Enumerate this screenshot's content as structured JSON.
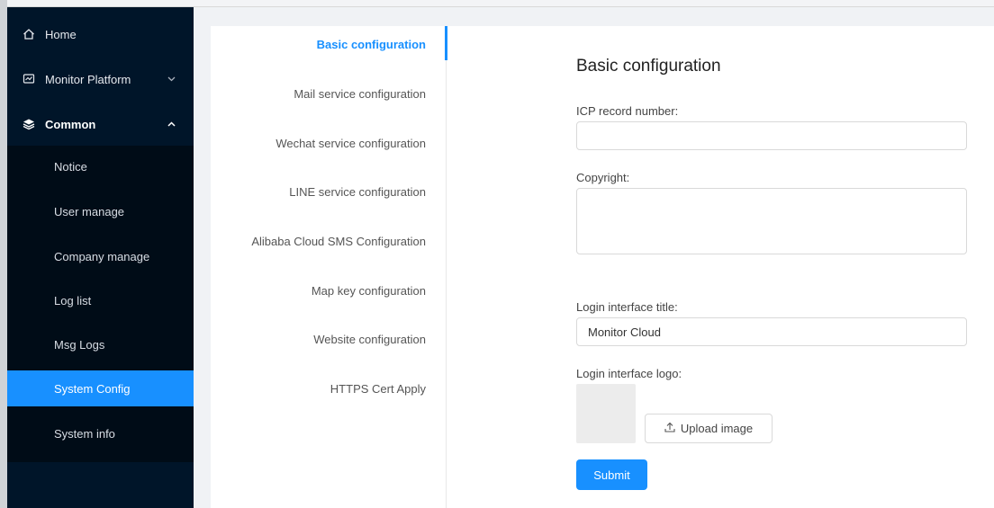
{
  "sidebar": {
    "items": [
      {
        "label": "Home",
        "icon": "home-icon"
      },
      {
        "label": "Monitor Platform",
        "icon": "monitor-icon",
        "chevron": "chevron-down-icon"
      },
      {
        "label": "Common",
        "icon": "layers-icon",
        "chevron": "chevron-up-icon"
      }
    ],
    "submenu": [
      {
        "label": "Notice"
      },
      {
        "label": "User manage"
      },
      {
        "label": "Company manage"
      },
      {
        "label": "Log list"
      },
      {
        "label": "Msg Logs"
      },
      {
        "label": "System Config",
        "active": true
      },
      {
        "label": "System info"
      }
    ]
  },
  "tabs": [
    {
      "label": "Basic configuration",
      "active": true
    },
    {
      "label": "Mail service configuration"
    },
    {
      "label": "Wechat service configuration"
    },
    {
      "label": "LINE service configuration"
    },
    {
      "label": "Alibaba Cloud SMS Configuration"
    },
    {
      "label": "Map key configuration"
    },
    {
      "label": "Website configuration"
    },
    {
      "label": "HTTPS Cert Apply"
    }
  ],
  "form": {
    "title": "Basic configuration",
    "icp_label": "ICP record number:",
    "icp_value": "",
    "copyright_label": "Copyright:",
    "copyright_value": "",
    "login_title_label": "Login interface title:",
    "login_title_value": "Monitor Cloud",
    "logo_label": "Login interface logo:",
    "upload_label": "Upload image",
    "submit_label": "Submit"
  },
  "colors": {
    "sidebar_bg": "#001529",
    "submenu_bg": "#000c17",
    "accent": "#1890ff"
  }
}
